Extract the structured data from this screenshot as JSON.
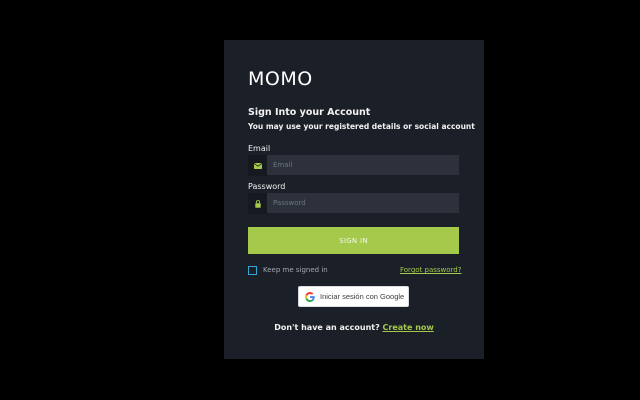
{
  "brand": {
    "name": "MOMO"
  },
  "form": {
    "heading": "Sign Into your Account",
    "subheading": "You may use your registered details or social account",
    "email": {
      "label": "Email",
      "placeholder": "Email",
      "value": "",
      "icon": "envelope-icon"
    },
    "password": {
      "label": "Password",
      "placeholder": "Password",
      "value": "",
      "icon": "lock-icon"
    },
    "submit_label": "SIGN IN",
    "keep_signed_in": {
      "label": "Keep me signed in",
      "checked": false
    },
    "forgot_password": "Forgot password?",
    "google_button": {
      "label": "Iniciar sesión con Google",
      "icon": "google-icon"
    },
    "footer": {
      "prompt": "Don't have an account?",
      "link": "Create now"
    }
  },
  "colors": {
    "page_background": "#000000",
    "card_background": "#1b1f27",
    "input_background": "#2c313b",
    "accent": "#a4c94b",
    "checkbox_border": "#39a5d6"
  }
}
